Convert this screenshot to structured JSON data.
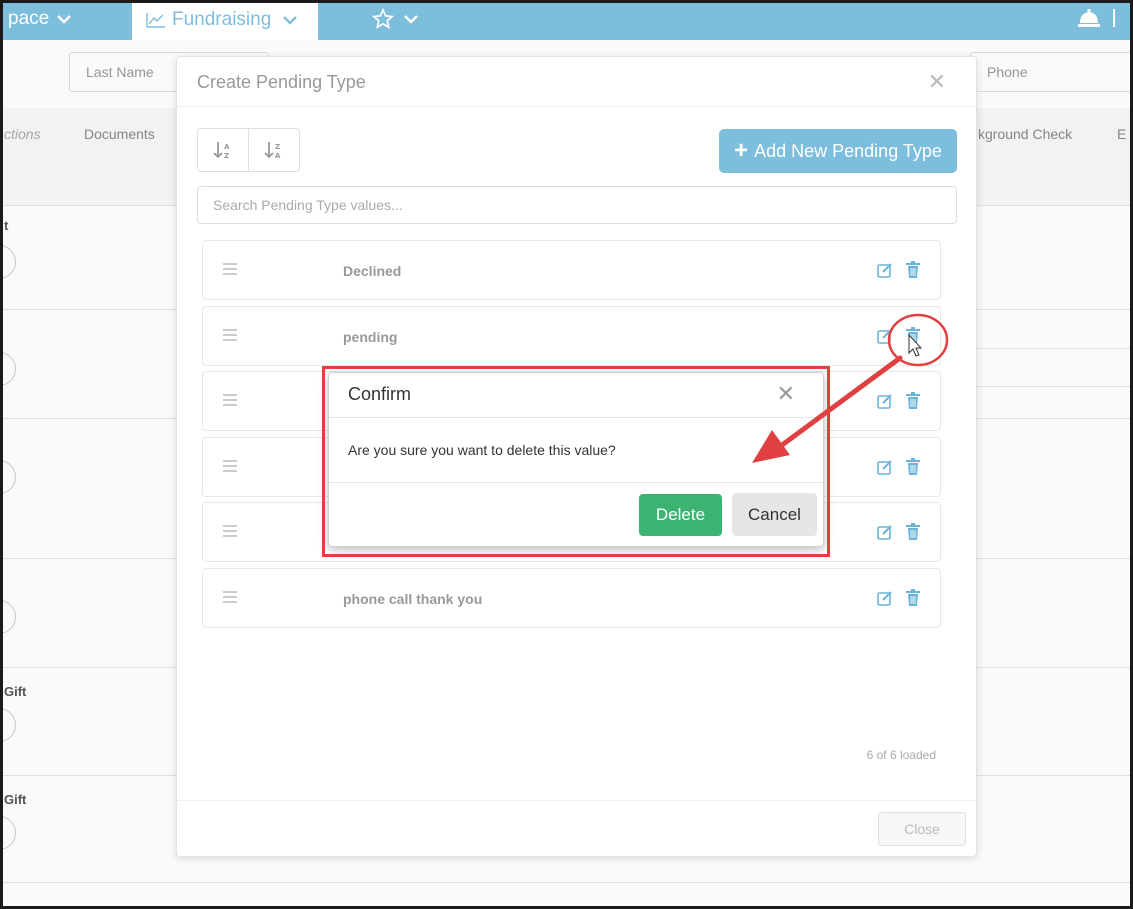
{
  "topnav": {
    "workspace_label": "pace",
    "fundraising_label": "Fundraising"
  },
  "background": {
    "fields": [
      "Last Name",
      "Phone"
    ],
    "tabs": [
      "ctions",
      "Documents",
      "kground Check",
      "E"
    ],
    "row_labels": [
      "t",
      "Gift",
      "Gift"
    ]
  },
  "modal": {
    "title": "Create Pending Type",
    "add_button_label": "Add New Pending Type",
    "search_placeholder": "Search Pending Type values...",
    "items": [
      "Declined",
      "pending",
      "",
      "",
      "",
      "phone call thank you"
    ],
    "loaded_text": "6 of 6 loaded",
    "close_label": "Close"
  },
  "confirm": {
    "title": "Confirm",
    "message": "Are you sure you want to delete this value?",
    "delete_label": "Delete",
    "cancel_label": "Cancel"
  },
  "colors": {
    "topbar": "#7dbedd",
    "delete_button": "#3cb371",
    "annotation": "#e04040",
    "icon_blue": "#6bb4d8"
  }
}
